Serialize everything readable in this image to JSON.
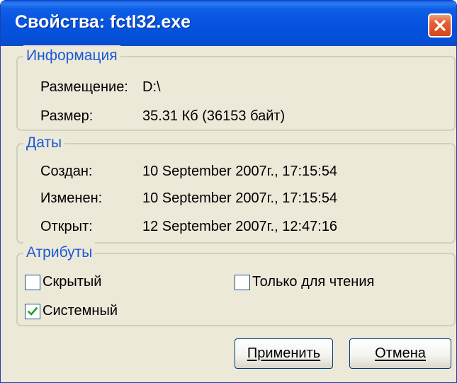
{
  "window": {
    "title": "Свойства: fctl32.exe"
  },
  "info": {
    "legend": "Информация",
    "location_label": "Размещение:",
    "location_value": "D:\\",
    "size_label": "Размер:",
    "size_value": "35.31 Кб (36153 байт)"
  },
  "dates": {
    "legend": "Даты",
    "created_label": "Создан:",
    "created_value": "10 September 2007г., 17:15:54",
    "modified_label": "Изменен:",
    "modified_value": "10 September 2007г., 17:15:54",
    "opened_label": "Открыт:",
    "opened_value": "12 September 2007г., 12:47:16"
  },
  "attributes": {
    "legend": "Атрибуты",
    "hidden_label": "Скрытый",
    "hidden_checked": false,
    "system_label": "Системный",
    "system_checked": true,
    "readonly_label": "Только для чтения",
    "readonly_checked": false
  },
  "buttons": {
    "apply_label": "Применить",
    "cancel_label": "Отмена"
  },
  "colors": {
    "titlebar": "#0553df",
    "legend_text": "#1a59d8",
    "dialog_bg": "#ece9d8",
    "close_button": "#d5451d",
    "check_mark": "#21a121"
  }
}
